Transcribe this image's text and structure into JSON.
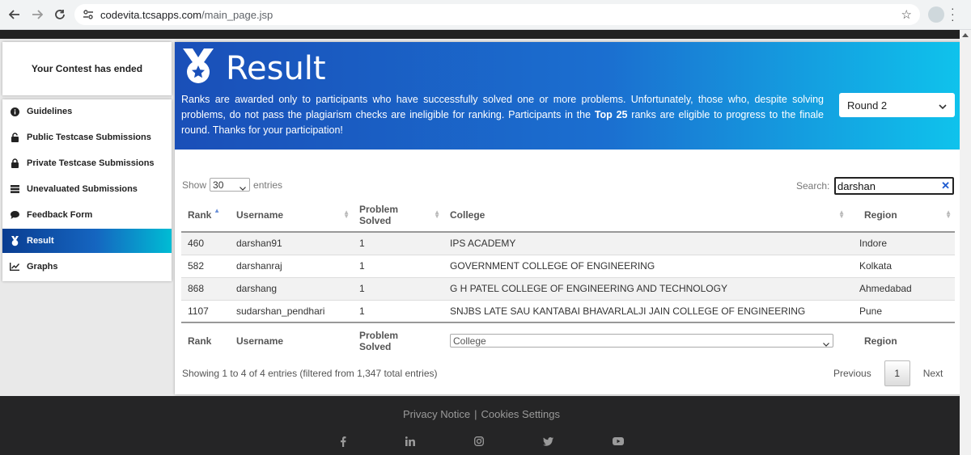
{
  "browser": {
    "url_domain": "codevita.tcsapps.com",
    "url_path": "/main_page.jsp"
  },
  "sidebar": {
    "status": "Your Contest has ended",
    "items": [
      {
        "label": "Guidelines",
        "icon": "info-icon"
      },
      {
        "label": "Public Testcase Submissions",
        "icon": "unlock-icon"
      },
      {
        "label": "Private Testcase Submissions",
        "icon": "lock-icon"
      },
      {
        "label": "Unevaluated Submissions",
        "icon": "stack-icon"
      },
      {
        "label": "Feedback Form",
        "icon": "comment-icon"
      },
      {
        "label": "Result",
        "icon": "medal-icon",
        "active": true
      },
      {
        "label": "Graphs",
        "icon": "chart-icon"
      }
    ]
  },
  "result": {
    "title": "Result",
    "description_part1": "Ranks are awarded only to participants who have successfully solved one or more problems. Unfortunately, those who, despite solving problems, do not pass the plagiarism checks are ineligible for ranking. Participants in the ",
    "description_bold": "Top 25",
    "description_part2": " ranks are eligible to progress to the finale round. Thanks for your participation!",
    "round_selected": "Round 2"
  },
  "table_controls": {
    "show_label": "Show",
    "entries_value": "30",
    "entries_label": "entries",
    "search_label": "Search:",
    "search_value": "darshan",
    "clear_glyph": "✕"
  },
  "table": {
    "headers": [
      "Rank",
      "Username",
      "Problem Solved",
      "College",
      "Region"
    ],
    "rows": [
      {
        "rank": "460",
        "username": "darshan91",
        "solved": "1",
        "college": "IPS ACADEMY",
        "region": "Indore"
      },
      {
        "rank": "582",
        "username": "darshanraj",
        "solved": "1",
        "college": "GOVERNMENT COLLEGE OF ENGINEERING",
        "region": "Kolkata"
      },
      {
        "rank": "868",
        "username": "darshang",
        "solved": "1",
        "college": "G H PATEL COLLEGE OF ENGINEERING AND TECHNOLOGY",
        "region": "Ahmedabad"
      },
      {
        "rank": "1107",
        "username": "sudarshan_pendhari",
        "solved": "1",
        "college": "SNJBS LATE SAU KANTABAI BHAVARLALJI JAIN COLLEGE OF ENGINEERING",
        "region": "Pune"
      }
    ],
    "footer_college_filter": "College"
  },
  "pagination": {
    "info": "Showing 1 to 4 of 4 entries (filtered from 1,347 total entries)",
    "previous": "Previous",
    "current": "1",
    "next": "Next"
  },
  "footer": {
    "privacy": "Privacy Notice",
    "separator": "|",
    "cookies": "Cookies Settings",
    "social_icons": [
      "facebook-icon",
      "linkedin-icon",
      "instagram-icon",
      "twitter-icon",
      "youtube-icon"
    ]
  },
  "colors": {
    "banner_start": "#1a4fb8",
    "banner_end": "#0fc3ec",
    "footer_bg": "#252526"
  }
}
